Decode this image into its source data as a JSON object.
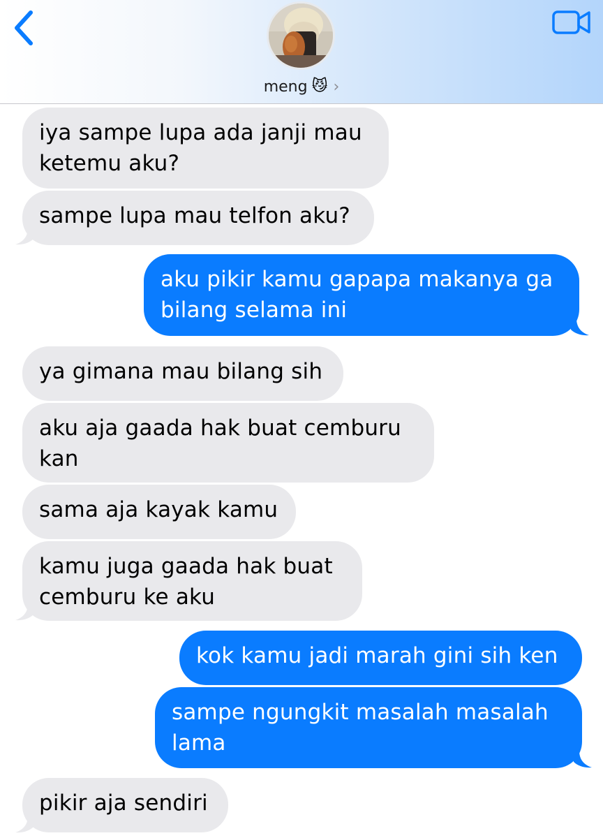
{
  "header": {
    "back_icon": "chevron-left-icon",
    "video_icon": "video-camera-icon",
    "contact_name": "meng",
    "contact_emoji": "😼",
    "chevron": "›",
    "accent_color": "#0a7cff"
  },
  "messages": [
    {
      "direction": "in",
      "lines": [
        "iya sampe lupa ada janji mau",
        "ketemu aku?"
      ]
    },
    {
      "direction": "in",
      "lines": [
        "sampe lupa mau telfon aku?"
      ]
    },
    {
      "direction": "out",
      "lines": [
        "aku pikir kamu gapapa makanya ga",
        "bilang selama ini"
      ]
    },
    {
      "direction": "in",
      "lines": [
        "ya gimana mau bilang sih"
      ]
    },
    {
      "direction": "in",
      "lines": [
        "aku aja gaada hak buat cemburu",
        "kan"
      ]
    },
    {
      "direction": "in",
      "lines": [
        "sama aja kayak kamu"
      ]
    },
    {
      "direction": "in",
      "lines": [
        "kamu juga gaada hak buat",
        "cemburu ke aku"
      ]
    },
    {
      "direction": "out",
      "lines": [
        "kok kamu jadi marah gini sih ken"
      ]
    },
    {
      "direction": "out",
      "lines": [
        "sampe ngungkit masalah masalah",
        "lama"
      ]
    },
    {
      "direction": "in",
      "lines": [
        "pikir aja sendiri"
      ]
    }
  ]
}
